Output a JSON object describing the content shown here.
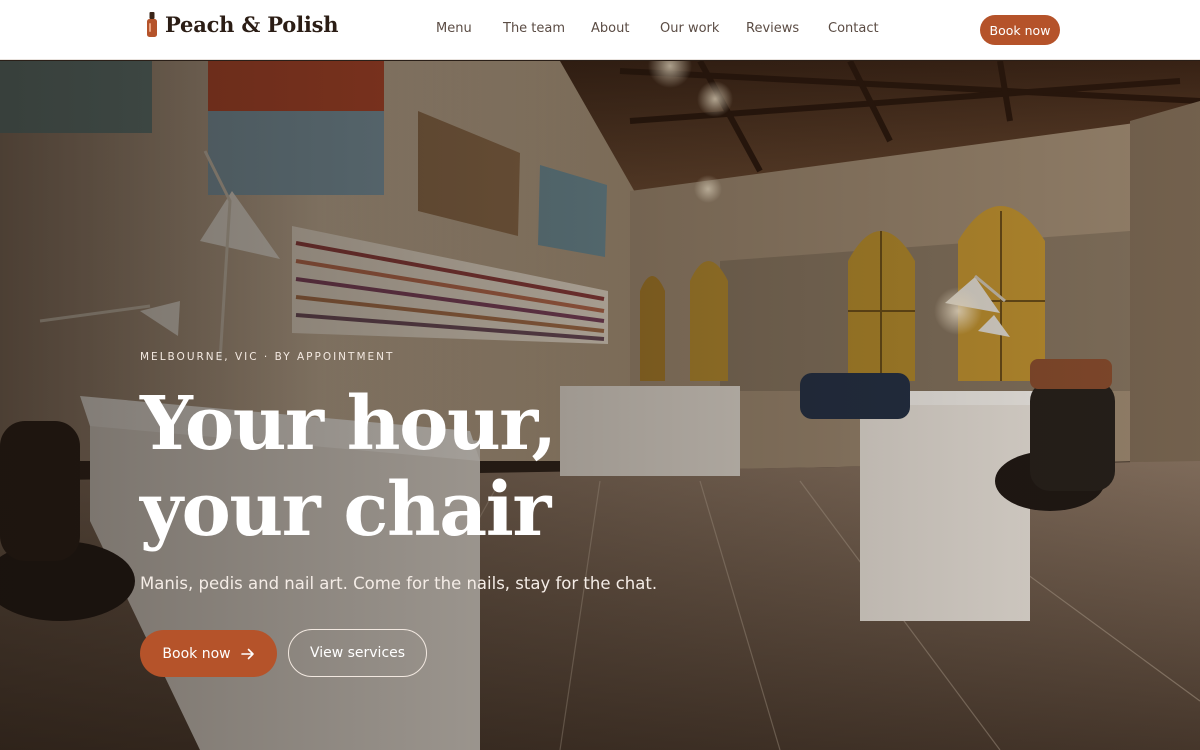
{
  "brand": {
    "name": "Peach & Polish",
    "icon": "nail-polish-bottle-icon"
  },
  "nav": {
    "items": [
      {
        "label": "Menu"
      },
      {
        "label": "The team"
      },
      {
        "label": "About"
      },
      {
        "label": "Our work"
      },
      {
        "label": "Reviews"
      },
      {
        "label": "Contact"
      }
    ],
    "cta_label": "Book now"
  },
  "hero": {
    "eyebrow": "MELBOURNE, VIC · BY APPOINTMENT",
    "headline_line1": "Your hour,",
    "headline_line2": "your chair",
    "subhead": "Manis, pedis and nail art. Come for the nails, stay for the chat.",
    "primary_button": {
      "label": "Book now",
      "icon": "arrow-right-icon"
    },
    "secondary_button": {
      "label": "View services"
    }
  },
  "colors": {
    "accent": "#b5532a",
    "header_bg": "#ffffff",
    "brand_text": "#2b1d15",
    "nav_text": "#5b4c44"
  }
}
